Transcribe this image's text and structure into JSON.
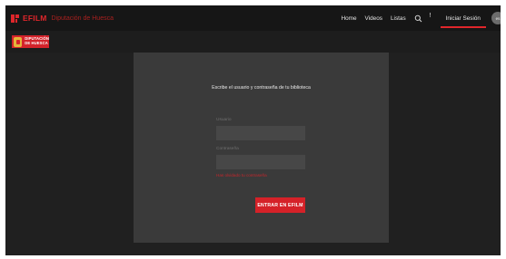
{
  "brand": {
    "name": "EFILM",
    "subtitle": "Diputación de Huesca",
    "color": "#e0262b"
  },
  "nav": {
    "items": [
      "Home",
      "Videos",
      "Listas"
    ],
    "search_icon": "search-icon",
    "alert_glyph": "!",
    "login_label": "Iniciar Sesión",
    "language": "es"
  },
  "institution": {
    "line1": "DIPUTACIÓN",
    "line2": "DE HUESCA",
    "color": "#d4232b"
  },
  "login": {
    "title": "Escribe el usuario y contraseña de tu biblioteca",
    "user_label": "Usuario",
    "user_value": "",
    "password_label": "Contraseña",
    "password_value": "",
    "error": "Has olvidado tu contraseña",
    "submit_label": "ENTRAR EN EFILM",
    "accent": "#d52128"
  }
}
